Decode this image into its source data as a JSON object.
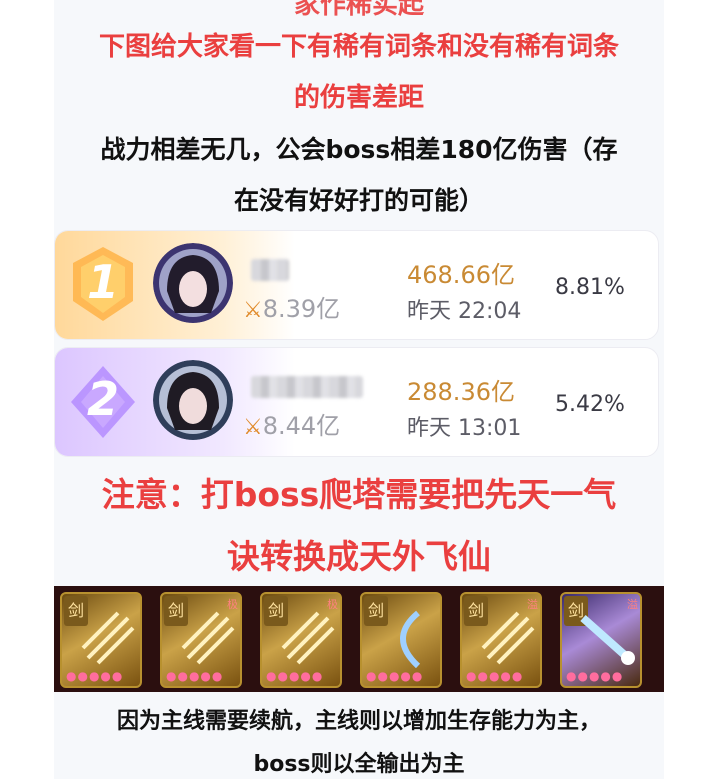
{
  "header_partial": "家作稀实起",
  "intro": {
    "line1": "下图给大家看一下有稀有词条和没有稀有词条",
    "line2": "的伤害差距"
  },
  "compare": {
    "line1": "战力相差无几，公会boss相差180亿伤害（存",
    "line2": "在没有好好打的可能）"
  },
  "ranks": [
    {
      "rank": "1",
      "power": "8.39亿",
      "damage": "468.66亿",
      "time": "昨天 22:04",
      "percent": "8.81%",
      "power_icon": "crossed-swords-icon"
    },
    {
      "rank": "2",
      "power": "8.44亿",
      "damage": "288.36亿",
      "time": "昨天 13:01",
      "percent": "5.42%",
      "power_icon": "crossed-swords-icon"
    }
  ],
  "notice": {
    "line1": "注意：打boss爬塔需要把先天一气",
    "line2": "诀转换成天外飞仙"
  },
  "skills": [
    {
      "tag": "剑",
      "corner": "",
      "icon": "blade-rain-icon"
    },
    {
      "tag": "剑",
      "corner": "极",
      "icon": "blade-rain-icon"
    },
    {
      "tag": "剑",
      "corner": "极",
      "icon": "blade-rain-icon"
    },
    {
      "tag": "剑",
      "corner": "",
      "icon": "crescent-slash-icon"
    },
    {
      "tag": "剑",
      "corner": "溢",
      "icon": "blade-rain-icon"
    },
    {
      "tag": "剑",
      "corner": "溢",
      "icon": "meteor-icon"
    }
  ],
  "footer": {
    "line1": "因为主线需要续航，主线则以增加生存能力为主，",
    "line2": "boss则以全输出为主"
  },
  "colors": {
    "accent_red": "#ea3f3f",
    "damage_gold": "#c98a34",
    "rank1_band": "#ffe3b0",
    "rank2_band": "#e7d6ff"
  }
}
